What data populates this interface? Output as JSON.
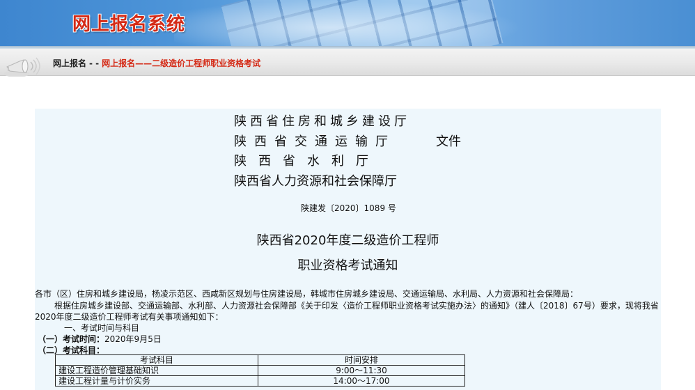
{
  "header": {
    "title": "网上报名系统",
    "title_color": "#d42a16",
    "banner_color": "#4d94d8"
  },
  "breadcrumb": {
    "icon": "horn-icon",
    "home": "网上报名",
    "separator": "- -",
    "current": "网上报名——二级造价工程师职业资格考试"
  },
  "document": {
    "issuers": [
      "陕西省住房和城乡建设厅",
      "陕西省交通运输厅",
      "陕西省水利厅",
      "陕西省人力资源和社会保障厅"
    ],
    "doc_label": "文件",
    "doc_number": "陕建发〔2020〕1089 号",
    "title_line1": "陕西省2020年度二级造价工程师",
    "title_line2": "职业资格考试通知",
    "addressee": "各市（区）住房和城乡建设局，杨凌示范区、西咸新区规划与住房建设局，韩城市住房城乡建设局、交通运输局、水利局、人力资源和社会保障局：",
    "body_line1": "根据住房城乡建设部、交通运输部、水利部、人力资源社会保障部《关于印发〈造价工程师职业资格考试实施办法〉的通知》（建人〔2018〕67号）要求，现将我省",
    "body_line2": "2020年度二级造价工程师考试有关事项通知如下：",
    "section1_title": "一、考试时间与科目",
    "exam_time_label": "（一）考试时间：",
    "exam_time_value": "2020年9月5日",
    "exam_subjects_label": "（二）考试科目：",
    "table": {
      "headers": [
        "考试科目",
        "时间安排"
      ],
      "rows": [
        [
          "建设工程造价管理基础知识",
          "9:00～11:30"
        ],
        [
          "建设工程计量与计价实务",
          "14:00～17:00"
        ]
      ]
    },
    "panel_color": "#eef7fc"
  }
}
